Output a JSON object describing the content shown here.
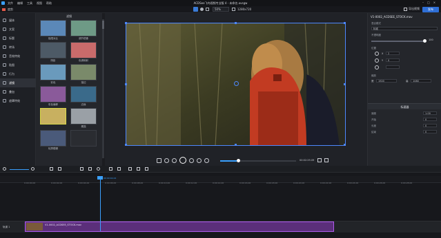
{
  "menu": [
    "文件",
    "编辑",
    "工具",
    "视图",
    "帮助"
  ],
  "window_title": "ACDSee飞鸟视频专业版 4 - 未命名.avsgw",
  "toolbar": {
    "open_label": "度剪",
    "zoom": "50%",
    "resolution": "1280x720",
    "export_label": "导出视频",
    "publish_label": "发布"
  },
  "sidebar": [
    {
      "label": "媒体",
      "icon": "media-icon"
    },
    {
      "label": "文案",
      "icon": "text-icon"
    },
    {
      "label": "标题",
      "icon": "title-icon"
    },
    {
      "label": "转场",
      "icon": "transition-icon"
    },
    {
      "label": "音效特效",
      "icon": "audio-icon"
    },
    {
      "label": "贴图",
      "icon": "sticker-icon"
    },
    {
      "label": "行为",
      "icon": "behavior-icon"
    },
    {
      "label": "滤镜",
      "icon": "filter-icon"
    },
    {
      "label": "叠加",
      "icon": "overlay-icon"
    },
    {
      "label": "遮罩特效",
      "icon": "mask-icon"
    }
  ],
  "effects": {
    "heading": "滤镜",
    "items": [
      "极限对比",
      "调节镜像",
      "阴影",
      "色调映射",
      "彩色",
      "描边",
      "彩色偏移",
      "边缘",
      "",
      "素描",
      "轮廓模糊",
      ""
    ]
  },
  "right_panel": {
    "clip_name": "V1-0002_ACDSEE_STOCK.mov",
    "blend_label": "混合模式",
    "blend_value": "标准",
    "opacity_label": "不透明度",
    "opacity_value": "100",
    "position_label": "位置",
    "x_label": "X",
    "x_value": "2",
    "y_label": "Y",
    "y_value": "0",
    "scale_label": "缩放",
    "w_label": "宽",
    "w_value": "1920",
    "h_label": "高",
    "h_value": "1080",
    "section2": "标速器",
    "speed_label": "速度",
    "speed_value": "1.00",
    "p2_label": "开始",
    "p2_value": "0",
    "p3_label": "长度",
    "p3_value": "0",
    "p4_label": "结束",
    "p4_value": "0"
  },
  "player": {
    "time": "00:02:29.09"
  },
  "ruler": {
    "ticks": [
      "0:00:00.00",
      "0:00:02.00",
      "0:00:04.00",
      "0:00:06.00",
      "0:00:08.00",
      "0:00:10.00",
      "0:00:12.00",
      "0:00:14.00",
      "0:00:16.00",
      "0:00:18.00",
      "0:00:20.00",
      "0:00:22.00",
      "0:00:24.00",
      "0:00:26.00",
      "0:00:28.00"
    ],
    "playhead_time": "00:00:02.24"
  },
  "track": {
    "label": "轨道 1",
    "clip": "V1-0002_ACDSEE_STOCK.mov"
  }
}
